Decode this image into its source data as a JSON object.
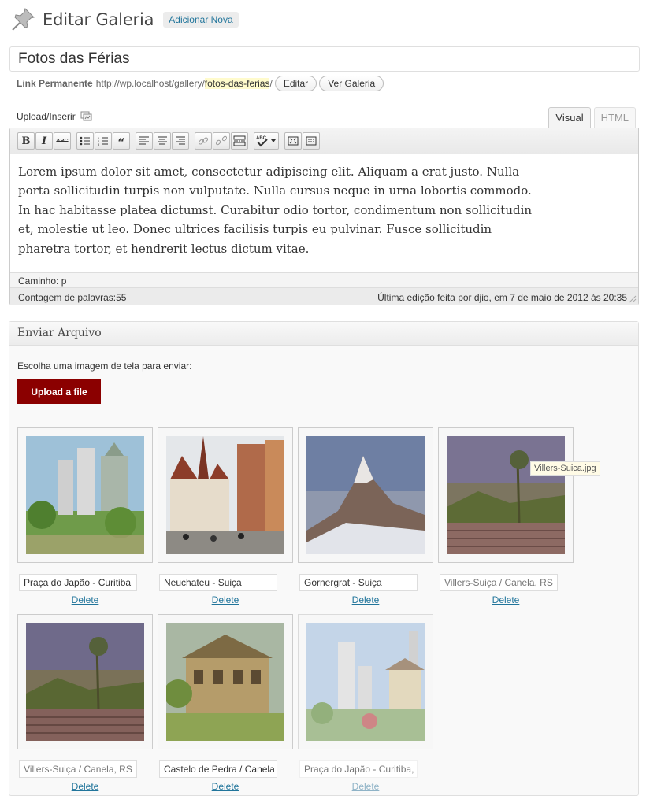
{
  "header": {
    "title": "Editar Galeria",
    "add_new": "Adicionar Nova"
  },
  "post": {
    "title_value": "Fotos das Férias",
    "permalink_label": "Link Permanente",
    "permalink_base": "http://wp.localhost/gallery/",
    "permalink_slug": "fotos-das-ferias",
    "permalink_tail": "/",
    "edit_button": "Editar",
    "view_button": "Ver Galeria"
  },
  "editor": {
    "upload_insert": "Upload/Inserir",
    "tabs": [
      {
        "label": "Visual",
        "active": true
      },
      {
        "label": "HTML",
        "active": false
      }
    ],
    "toolbar_icons": [
      "bold-icon",
      "italic-icon",
      "strikethrough-icon",
      "bullet-list-icon",
      "numbered-list-icon",
      "blockquote-icon",
      "align-left-icon",
      "align-center-icon",
      "align-right-icon",
      "link-icon",
      "unlink-icon",
      "more-tag-icon",
      "spellcheck-icon",
      "fullscreen-icon",
      "kitchen-sink-icon"
    ],
    "content": "Lorem ipsum dolor sit amet, consectetur adipiscing elit. Aliquam a erat justo. Nulla porta sollicitudin turpis non vulputate. Nulla cursus neque in urna lobortis commodo. In hac habitasse platea dictumst. Curabitur odio tortor, condimentum non sollicitudin et, molestie ut leo. Donec ultrices facilisis turpis eu pulvinar. Fusce sollicitudin pharetra tortor, et hendrerit lectus dictum vitae.",
    "path_label": "Caminho:",
    "path_value": "p",
    "word_count": "Contagem de palavras:55",
    "last_edit": "Última edição feita por djio, em 7 de maio de 2012 às 20:35"
  },
  "upload": {
    "heading": "Enviar Arquivo",
    "choose_text": "Escolha uma imagem de tela para enviar:",
    "button": "Upload a file",
    "tooltip": "Villers-Suica.jpg",
    "delete_label": "Delete",
    "images": [
      {
        "caption": "Praça do Japão - Curitiba",
        "scene": "city-garden"
      },
      {
        "caption": "Neuchateu - Suiça",
        "scene": "town-street"
      },
      {
        "caption": "Gornergrat - Suiça",
        "scene": "mountain"
      },
      {
        "caption": "Villers-Suiça / Canela, RS",
        "scene": "plaza"
      },
      {
        "caption": "Villers-Suiça / Canela, RS",
        "scene": "plaza"
      },
      {
        "caption": "Castelo de Pedra / Canela",
        "scene": "castle"
      },
      {
        "caption": "Praça do Japão - Curitiba,",
        "scene": "city-pagoda"
      }
    ]
  },
  "colors": {
    "upload_button": "#8b0000",
    "link": "#21759b",
    "slug_highlight": "#fffbcc"
  }
}
